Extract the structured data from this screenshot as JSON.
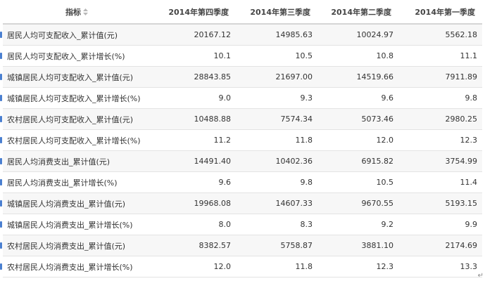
{
  "table": {
    "headers": [
      "指标",
      "2014年第四季度",
      "2014年第三季度",
      "2014年第二季度",
      "2014年第一季度"
    ],
    "rows": [
      {
        "name": "居民人均可支配收入_累计值(元)",
        "q4": "20167.12",
        "q3": "14985.63",
        "q2": "10024.97",
        "q1": "5562.18"
      },
      {
        "name": "居民人均可支配收入_累计增长(%)",
        "q4": "10.1",
        "q3": "10.5",
        "q2": "10.8",
        "q1": "11.1"
      },
      {
        "name": "城镇居民人均可支配收入_累计值(元)",
        "q4": "28843.85",
        "q3": "21697.00",
        "q2": "14519.66",
        "q1": "7911.89"
      },
      {
        "name": "城镇居民人均可支配收入_累计增长(%)",
        "q4": "9.0",
        "q3": "9.3",
        "q2": "9.6",
        "q1": "9.8"
      },
      {
        "name": "农村居民人均可支配收入_累计值(元)",
        "q4": "10488.88",
        "q3": "7574.34",
        "q2": "5073.46",
        "q1": "2980.25"
      },
      {
        "name": "农村居民人均可支配收入_累计增长(%)",
        "q4": "11.2",
        "q3": "11.8",
        "q2": "12.0",
        "q1": "12.3"
      },
      {
        "name": "居民人均消费支出_累计值(元)",
        "q4": "14491.40",
        "q3": "10402.36",
        "q2": "6915.82",
        "q1": "3754.99"
      },
      {
        "name": "居民人均消费支出_累计增长(%)",
        "q4": "9.6",
        "q3": "9.8",
        "q2": "10.5",
        "q1": "11.4"
      },
      {
        "name": "城镇居民人均消费支出_累计值(元)",
        "q4": "19968.08",
        "q3": "14607.33",
        "q2": "9670.55",
        "q1": "5193.15"
      },
      {
        "name": "城镇居民人均消费支出_累计增长(%)",
        "q4": "8.0",
        "q3": "8.3",
        "q2": "9.2",
        "q1": "9.9"
      },
      {
        "name": "农村居民人均消费支出_累计值(元)",
        "q4": "8382.57",
        "q3": "5758.87",
        "q2": "3881.10",
        "q1": "2174.69"
      },
      {
        "name": "农村居民人均消费支出_累计增长(%)",
        "q4": "12.0",
        "q3": "11.8",
        "q2": "12.3",
        "q1": "13.3"
      }
    ]
  },
  "icons": {
    "sort": "sort-icon",
    "row_marker": "row-marker-icon",
    "return_mark": "paragraph-return-icon"
  },
  "colors": {
    "header_text": "#444444",
    "cell_text": "#333333",
    "stripe": "#f7f7f7",
    "marker": "#4a7fd0"
  },
  "page": {
    "return_mark": "↵"
  }
}
